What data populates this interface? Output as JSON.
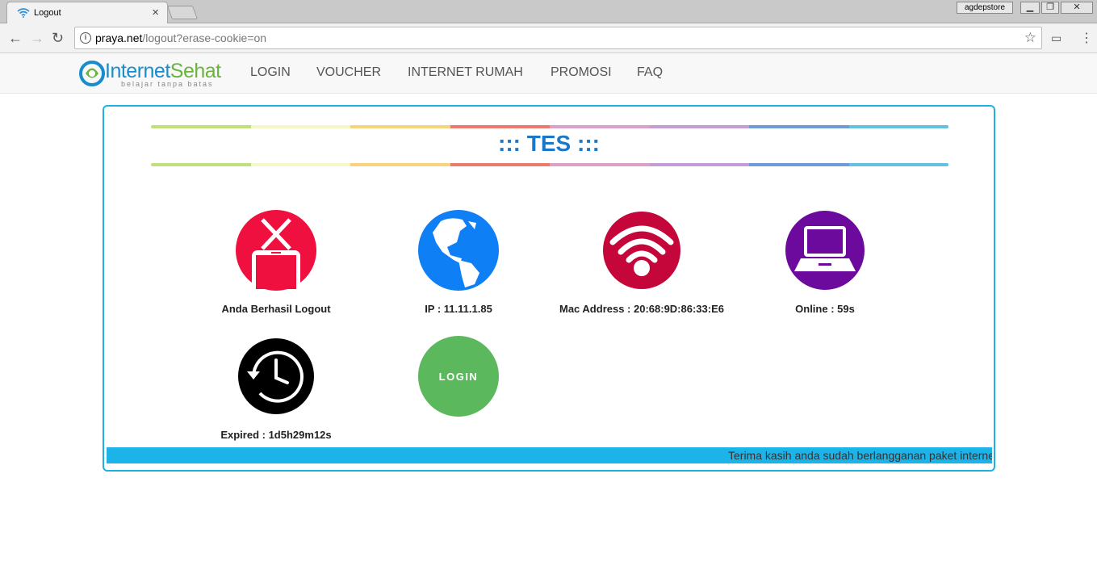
{
  "browser": {
    "tab_title": "Logout",
    "tab_close": "×",
    "profile_name": "agdepstore",
    "url_host": "praya.net",
    "url_path": "/logout?erase-cookie=on"
  },
  "site": {
    "logo_part1": "Internet",
    "logo_part2": "Sehat",
    "logo_tagline": "belajar tanpa batas",
    "nav": [
      "LOGIN",
      "VOUCHER",
      "INTERNET RUMAH",
      "PROMOSI",
      "FAQ"
    ]
  },
  "panel": {
    "title": "::: TES :::",
    "rainbow_colors": [
      "#bfe07a",
      "#f5f7c8",
      "#f7d37e",
      "#ec7a6c",
      "#dba0c8",
      "#c59bd6",
      "#6f9ad8",
      "#63c0e0"
    ],
    "tiles": [
      {
        "label": "Anda Berhasil Logout",
        "color": "#f0103f"
      },
      {
        "label": "IP : 11.11.1.85",
        "color": "#0f7ff5"
      },
      {
        "label": "Mac Address : 20:68:9D:86:33:E6",
        "color": "#c4063a"
      },
      {
        "label": "Online : 59s",
        "color": "#6c0a9e"
      },
      {
        "label": "Expired : 1d5h29m12s",
        "color": "#000000"
      }
    ],
    "login_button": "LOGIN",
    "login_color": "#5cb85c",
    "ticker": "Terima kasih anda sudah berlangganan paket internet"
  }
}
